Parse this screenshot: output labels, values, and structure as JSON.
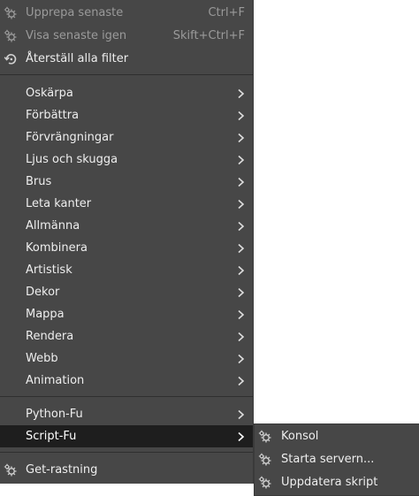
{
  "filters_menu": {
    "repeat_last": {
      "label": "Upprepa senaste",
      "shortcut": "Ctrl+F"
    },
    "reshow_last": {
      "label": "Visa senaste igen",
      "shortcut": "Skift+Ctrl+F"
    },
    "reset_all": {
      "label": "Återställ alla filter"
    },
    "categories": [
      {
        "label": "Oskärpa"
      },
      {
        "label": "Förbättra"
      },
      {
        "label": "Förvrängningar"
      },
      {
        "label": "Ljus och skugga"
      },
      {
        "label": "Brus"
      },
      {
        "label": "Leta kanter"
      },
      {
        "label": "Allmänna"
      },
      {
        "label": "Kombinera"
      },
      {
        "label": "Artistisk"
      },
      {
        "label": "Dekor"
      },
      {
        "label": "Mappa"
      },
      {
        "label": "Rendera"
      },
      {
        "label": "Webb"
      },
      {
        "label": "Animation"
      }
    ],
    "python_fu": {
      "label": "Python-Fu"
    },
    "script_fu": {
      "label": "Script-Fu"
    },
    "gegl_graph": {
      "label": "Get-rastning"
    }
  },
  "script_fu_submenu": {
    "items": [
      {
        "label": "Konsol"
      },
      {
        "label": "Starta servern..."
      },
      {
        "label": "Uppdatera skript"
      }
    ]
  },
  "colors": {
    "menu_bg": "#474747",
    "active_bg": "#1e1e1e",
    "text": "#eeeeee",
    "disabled_text": "#9a9a9a"
  }
}
